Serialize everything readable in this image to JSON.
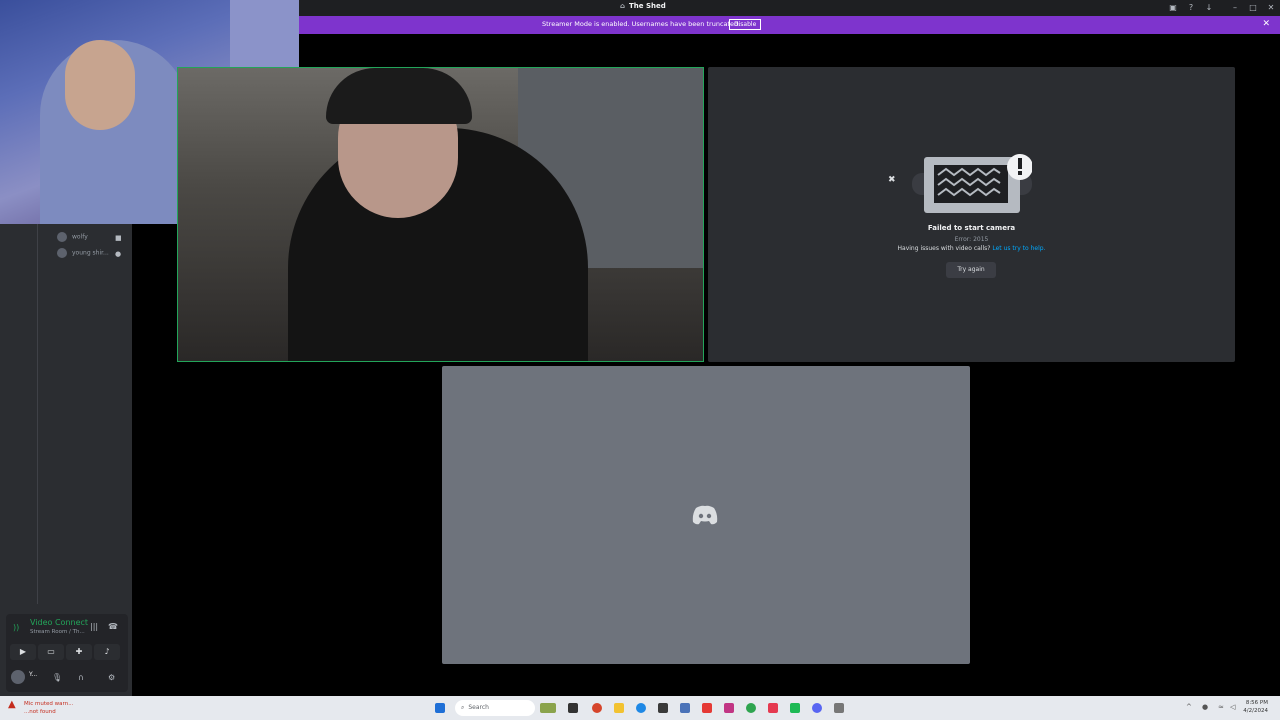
{
  "window": {
    "title": "The Shed"
  },
  "banner": {
    "message": "Streamer Mode is enabled. Usernames have been truncated.",
    "disable_label": "Disable"
  },
  "sidebar": {
    "voice_users": [
      {
        "name": "wolfy",
        "icon": "video-icon"
      },
      {
        "name": "young shir...",
        "icon": "status-icon"
      }
    ]
  },
  "voice_panel": {
    "status": "Video Connect",
    "channel": "Stream Room / Th...",
    "username": "Y...",
    "buttons": [
      "camera-icon",
      "screen-share-icon",
      "activities-icon",
      "soundboard-icon"
    ]
  },
  "error_tile": {
    "title": "Failed to start camera",
    "code": "Error: 2015",
    "help_prefix": "Having issues with video calls?",
    "help_link": "Let us try to help.",
    "try_again": "Try again"
  },
  "taskbar": {
    "warning_line1": "Mic muted warn...",
    "warning_line2": "...not found",
    "search_placeholder": "Search",
    "clock_time": "8:56 PM",
    "clock_date": "4/2/2024"
  },
  "colors": {
    "banner": "#7e34cd",
    "connected": "#23a55a",
    "link": "#00a8fc",
    "speaking_border": "#23a55a"
  }
}
